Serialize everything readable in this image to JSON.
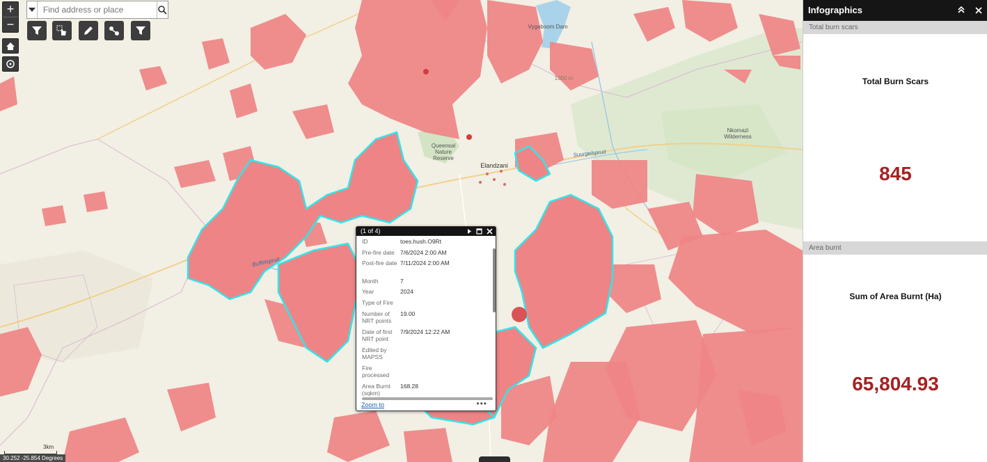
{
  "search": {
    "placeholder": "Find address or place"
  },
  "zoom": {
    "in": "+",
    "out": "−"
  },
  "map_labels": {
    "dam": "Vygeboom Dam",
    "reserve": "Queensal Nature Reserve",
    "town": "Elandzani",
    "river1": "Buffelspruit",
    "river2": "Suurgelspruit",
    "wilderness": "Nkomazi Wilderness",
    "elev": "1000 m"
  },
  "popup": {
    "header": "(1 of 4)",
    "fields": [
      {
        "k": "ID",
        "v": "toes.hush.O9Rt"
      },
      {
        "k": "Pre-fire date",
        "v": "7/6/2024 2:00 AM"
      },
      {
        "k": "Post-fire date",
        "v": "7/11/2024 2:00 AM"
      },
      {
        "k": "Month",
        "v": "7"
      },
      {
        "k": "Year",
        "v": "2024"
      },
      {
        "k": "Type of Fire",
        "v": ""
      },
      {
        "k": "Number of NRT points",
        "v": "19.00"
      },
      {
        "k": "Date of first NRT point",
        "v": "7/9/2024 12:22 AM"
      },
      {
        "k": "Edited by MAPSS",
        "v": ""
      },
      {
        "k": "Fire processed",
        "v": ""
      },
      {
        "k": "Area Burnt (sqkm)",
        "v": "168.28"
      }
    ],
    "zoom_to": "Zoom to",
    "more": "•••"
  },
  "scale": {
    "label": "3km"
  },
  "coords": "30.252 -25.854 Degrees",
  "panel": {
    "title": "Infographics",
    "collapse_icon": "chevron-up-icon",
    "close_icon": "close-icon",
    "section1": {
      "header": "Total burn scars",
      "title": "Total Burn Scars",
      "value": "845"
    },
    "section2": {
      "header": "Area burnt",
      "title": "Sum of Area Burnt (Ha)",
      "value": "65,804.93"
    }
  },
  "colors": {
    "burn_fill": "#ef8486",
    "highlight_outline": "#2fe6ea",
    "value_text": "#a52222",
    "panel_header": "#151515"
  }
}
